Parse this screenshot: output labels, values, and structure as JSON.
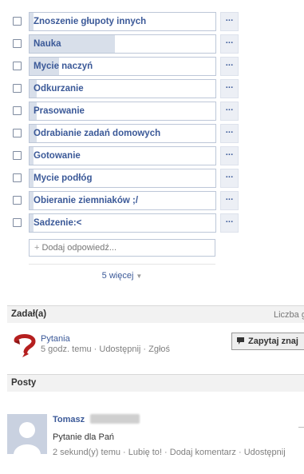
{
  "poll": {
    "options": [
      {
        "label": "Znoszenie głupoty innych",
        "fill": 0.02
      },
      {
        "label": "Nauka",
        "fill": 0.46
      },
      {
        "label": "Mycie naczyń",
        "fill": 0.16
      },
      {
        "label": "Odkurzanie",
        "fill": 0.04
      },
      {
        "label": "Prasowanie",
        "fill": 0.04
      },
      {
        "label": "Odrabianie zadań domowych",
        "fill": 0.04
      },
      {
        "label": "Gotowanie",
        "fill": 0.02
      },
      {
        "label": "Mycie podłóg",
        "fill": 0.02
      },
      {
        "label": "Obieranie ziemniaków ;/",
        "fill": 0.02
      },
      {
        "label": "Sadzenie:<",
        "fill": 0.02
      }
    ],
    "more_options_glyph": "···",
    "add_placeholder": "Dodaj odpowiedź...",
    "add_plus": "+",
    "more_link": "5 więcej",
    "more_caret": "▼"
  },
  "asked_section": {
    "title": "Zadał(a)",
    "right_text": "Liczba g"
  },
  "asker": {
    "icon": "questions-app-icon",
    "name": "Pytania",
    "time": "5 godz. temu",
    "share": "Udostępnij",
    "report": "Zgłoś",
    "sep": " · ",
    "ask_button": "Zapytaj znaj"
  },
  "posts_section": {
    "title": "Posty"
  },
  "post": {
    "author": "Tomasz",
    "text": "Pytanie dla Pań",
    "time": "2 sekund(y) temu",
    "like": "Lubię to!",
    "comment": "Dodaj komentarz",
    "share": "Udostępnij",
    "sep": " · "
  },
  "colors": {
    "link": "#3b5998",
    "bar_fill": "#d8dfea",
    "header_bg": "#f2f2f2"
  }
}
